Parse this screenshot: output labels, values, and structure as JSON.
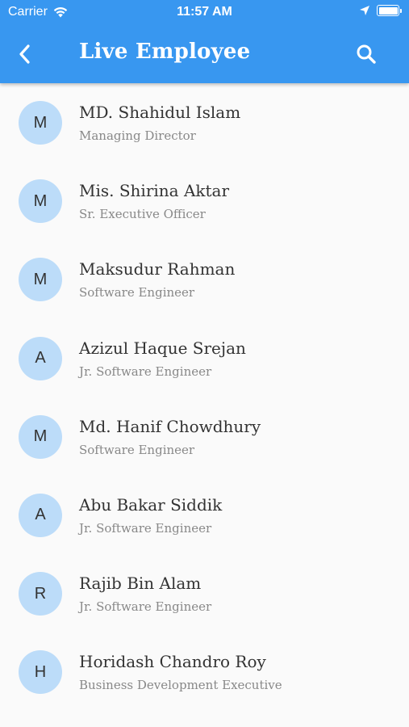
{
  "status_bar": {
    "carrier": "Carrier",
    "time": "11:57 AM",
    "icons": [
      "wifi-icon",
      "location-arrow-icon",
      "battery-icon"
    ]
  },
  "app_bar": {
    "title": "Live Employee",
    "back_icon": "chevron-left-icon",
    "search_icon": "search-icon",
    "color": "#3897f0"
  },
  "employees": [
    {
      "initial": "M",
      "name": "MD. Shahidul  Islam",
      "role": "Managing Director"
    },
    {
      "initial": "M",
      "name": "Mis. Shirina Aktar",
      "role": "Sr. Executive Officer"
    },
    {
      "initial": "M",
      "name": "Maksudur Rahman",
      "role": "Software Engineer"
    },
    {
      "initial": "A",
      "name": "Azizul Haque Srejan",
      "role": "Jr. Software Engineer"
    },
    {
      "initial": "M",
      "name": "Md. Hanif Chowdhury",
      "role": "Software Engineer"
    },
    {
      "initial": "A",
      "name": "Abu Bakar Siddik",
      "role": "Jr. Software Engineer"
    },
    {
      "initial": "R",
      "name": "Rajib Bin Alam",
      "role": "Jr. Software Engineer"
    },
    {
      "initial": "H",
      "name": "Horidash Chandro Roy",
      "role": "Business Development Executive"
    }
  ],
  "colors": {
    "avatar_bg": "#bcdcf9",
    "background": "#fafafa"
  }
}
